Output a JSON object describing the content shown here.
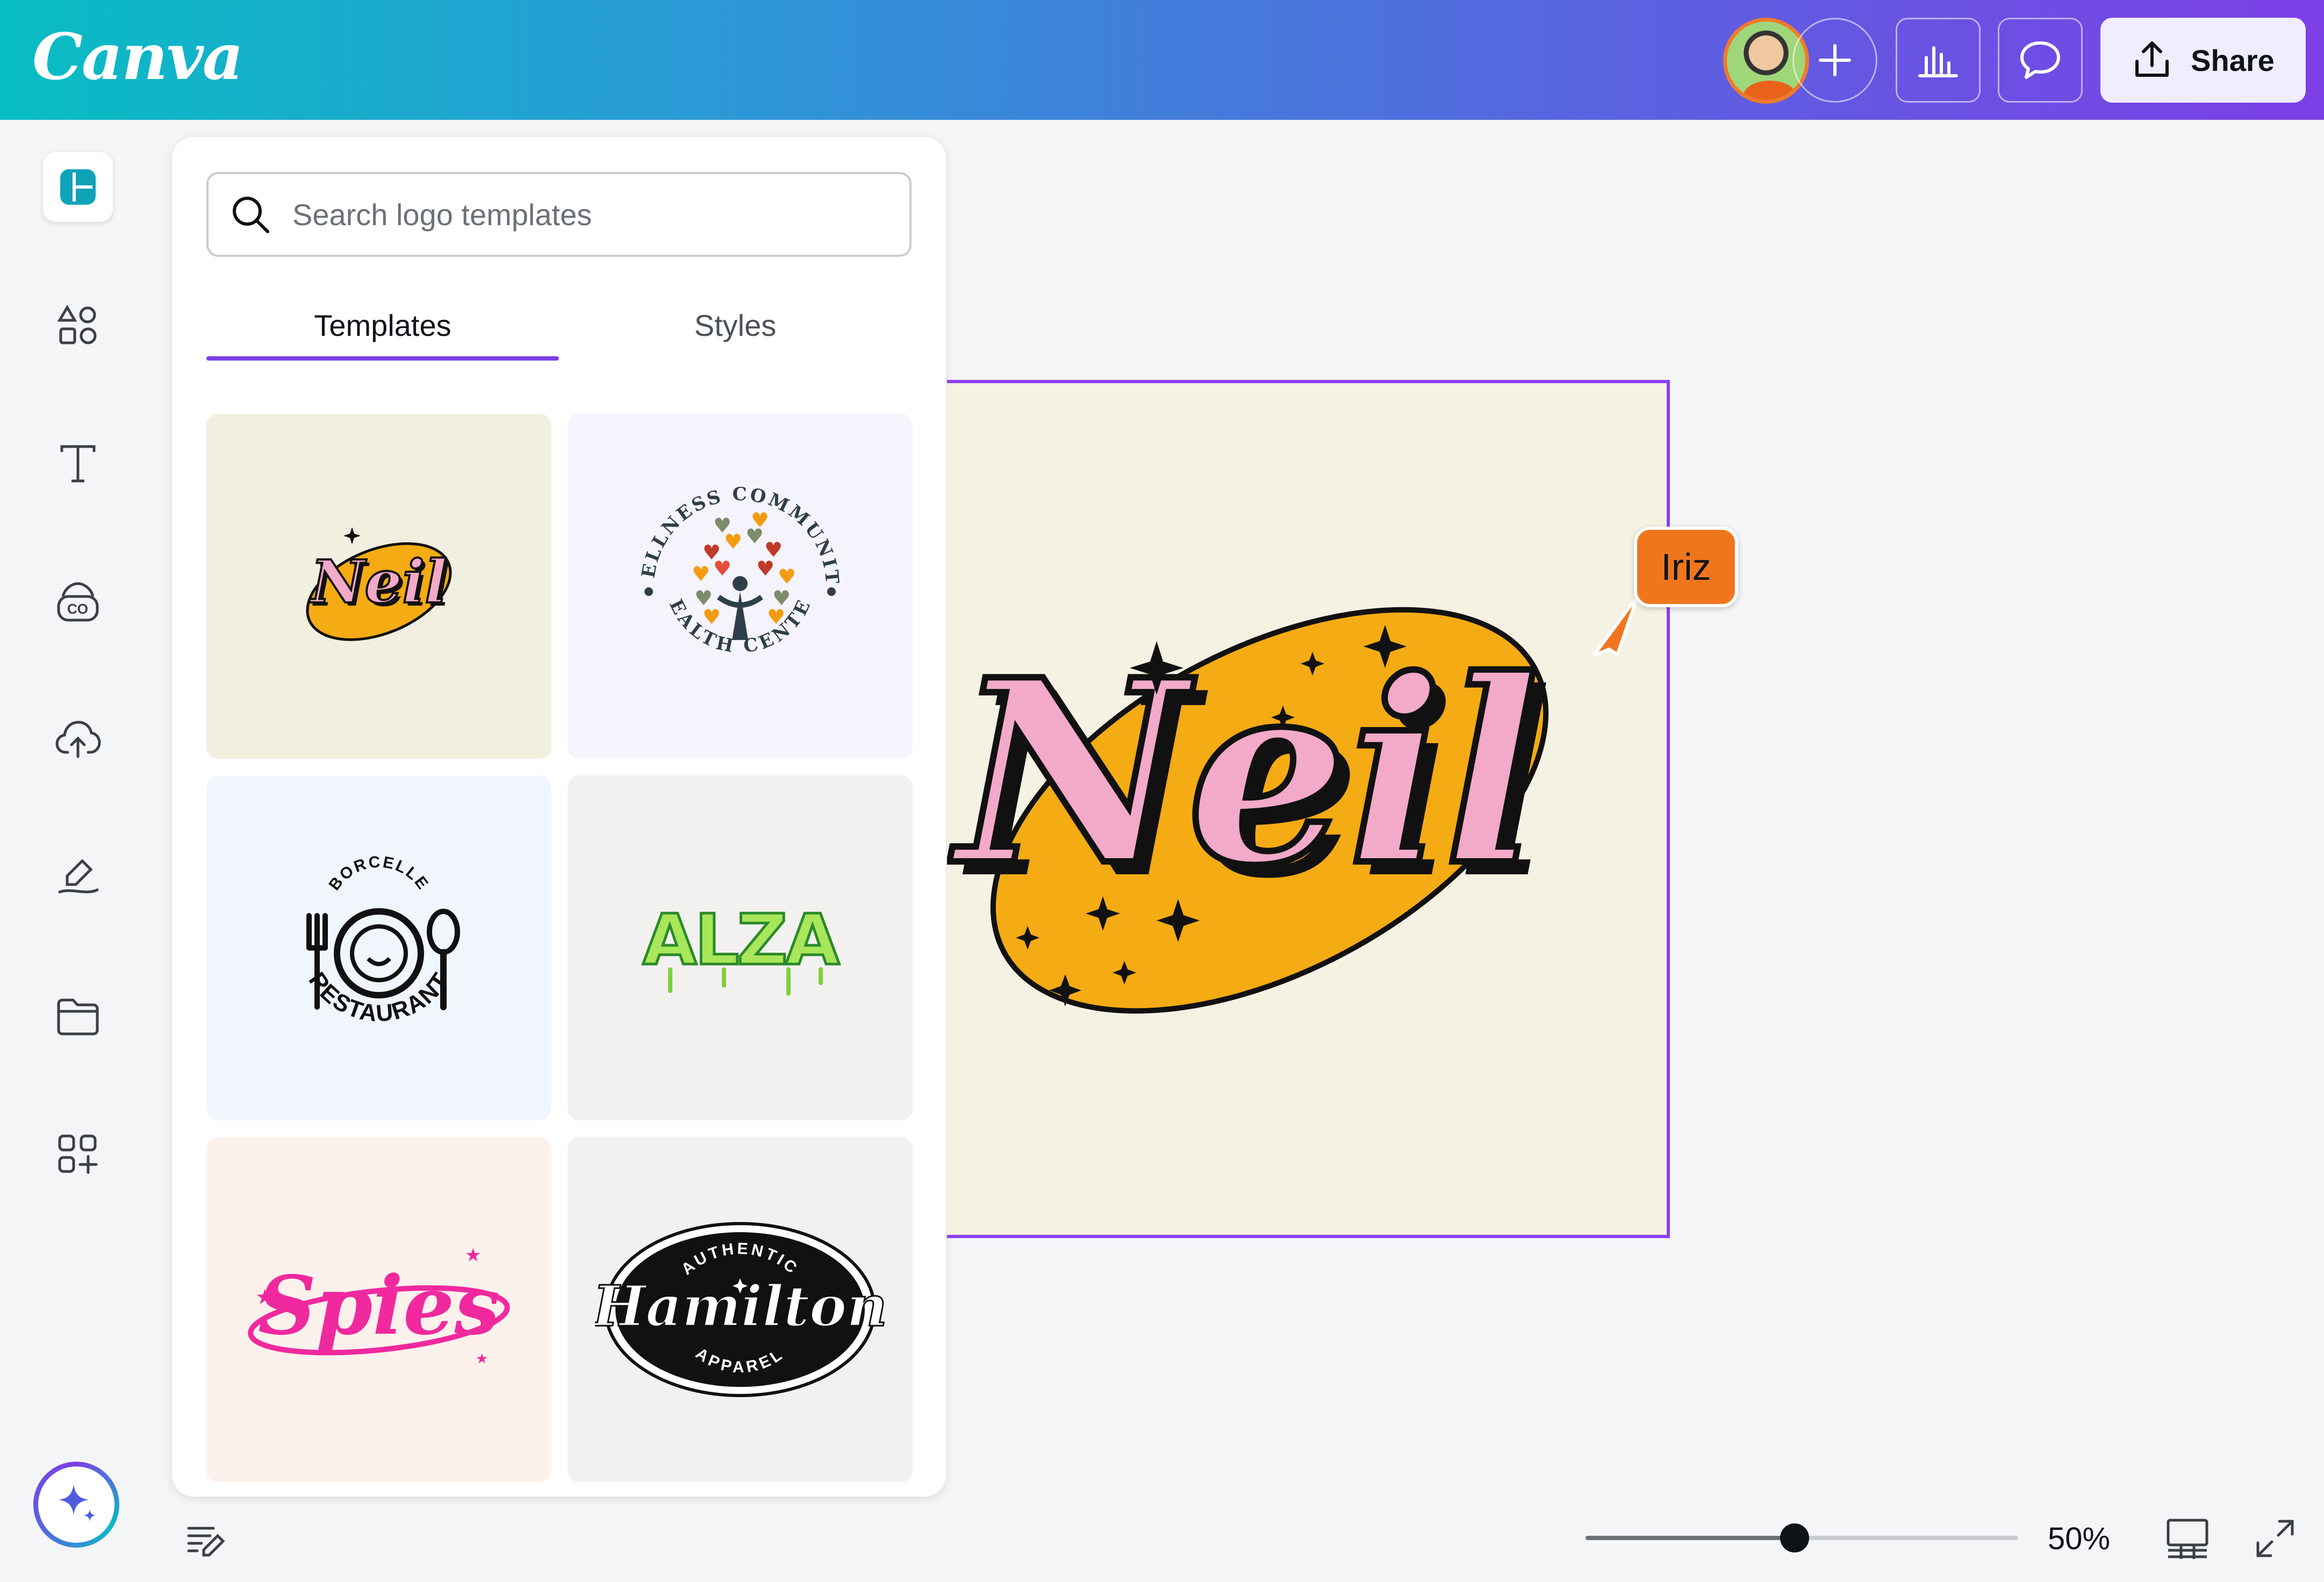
{
  "app": {
    "name": "Canva"
  },
  "topbar": {
    "logo_text": "Canva",
    "add_icon": "plus-icon",
    "analytics_icon": "bar-chart-icon",
    "comment_icon": "comment-bubble-icon",
    "share_label": "Share",
    "share_icon": "upload-icon"
  },
  "rail": {
    "items": [
      {
        "icon": "design-icon",
        "active": true
      },
      {
        "icon": "elements-icon"
      },
      {
        "icon": "text-icon"
      },
      {
        "icon": "brand-icon"
      },
      {
        "icon": "uploads-icon"
      },
      {
        "icon": "draw-icon"
      },
      {
        "icon": "projects-icon"
      },
      {
        "icon": "apps-icon"
      }
    ],
    "magic_icon": "sparkle-icon"
  },
  "panel": {
    "search_placeholder": "Search logo templates",
    "tabs": [
      {
        "label": "Templates",
        "active": true
      },
      {
        "label": "Styles",
        "active": false
      }
    ],
    "templates": [
      {
        "title": "Neil",
        "bg": "#f1efdf"
      },
      {
        "title_top": "WELLNESS COMMUNITY",
        "title_bottom": "HEALTH CENTER",
        "bg": "#f5f4fd"
      },
      {
        "title_top": "BORCELLE",
        "title_bottom": "RESTAURANT",
        "bg": "#f1f6fd"
      },
      {
        "title": "ALZA",
        "bg": "#f3f1f0"
      },
      {
        "title": "Spies",
        "bg": "#fdf1ec"
      },
      {
        "title_top": "AUTHENTIC",
        "title": "Hamilton",
        "title_bottom": "APPAREL",
        "bg": "#f2f1f1"
      }
    ]
  },
  "canvas": {
    "design_text": "Neil",
    "background": "#f4f2e3",
    "selection_color": "#8b3ff0"
  },
  "collaborator": {
    "name": "Iriz",
    "color": "#f0761e"
  },
  "bottom": {
    "notes_icon": "notes-icon",
    "zoom_value": "50%",
    "zoom_fraction": 0.5,
    "grid_icon": "grid-view-icon",
    "fullscreen_icon": "fullscreen-icon"
  }
}
